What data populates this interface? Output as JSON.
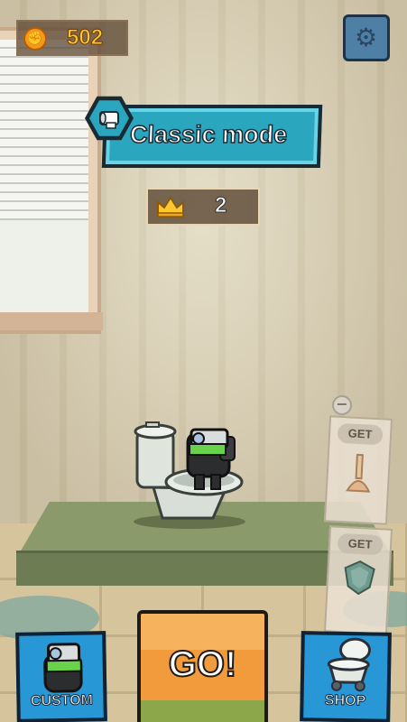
{
  "hud": {
    "coins": "502",
    "coin_icon": "coin-icon",
    "settings_icon": "gear-icon"
  },
  "mode": {
    "label": "Classic mode",
    "icon": "toilet-paper-icon",
    "accent": "#2aa6bf"
  },
  "level": {
    "icon": "crown-icon",
    "value": "2"
  },
  "offers": [
    {
      "label": "GET",
      "icon": "plunger-icon"
    },
    {
      "label": "GET",
      "icon": "shield-icon"
    }
  ],
  "minus_label": "−",
  "buttons": {
    "custom": "CUSTOM",
    "go": "GO!",
    "shop": "SHOP",
    "color": "#2797d6",
    "go_color": "#f29b3c"
  }
}
